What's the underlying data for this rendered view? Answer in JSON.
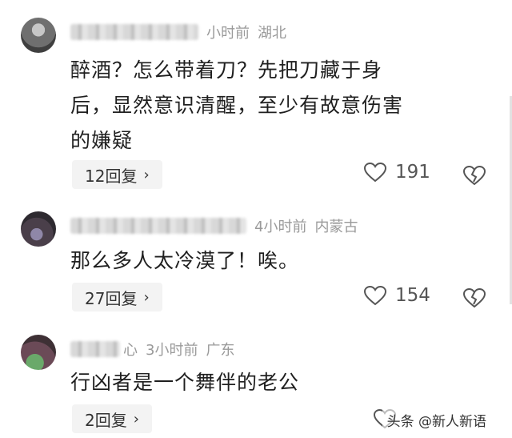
{
  "comments": [
    {
      "time": "小时前",
      "location": "湖北",
      "text_lines": [
        "醉酒？怎么带着刀？先把刀藏于身",
        "后，显然意识清醒，至少有故意伤害",
        "的嫌疑"
      ],
      "reply_label": "12回复",
      "likes": "191"
    },
    {
      "time": "4小时前",
      "location": "内蒙古",
      "text_lines": [
        "那么多人太冷漠了！唉。"
      ],
      "reply_label": "27回复",
      "likes": "154"
    },
    {
      "name_tail": "心",
      "time": "3小时前",
      "location": "广东",
      "text_lines": [
        "行凶者是一个舞伴的老公"
      ],
      "reply_label": "2回复"
    }
  ],
  "icons": {
    "chevron": "›",
    "like": "heart-outline-icon",
    "dislike": "broken-heart-icon"
  },
  "watermark": "头条 @新人新语",
  "colors": {
    "meta": "#9a9a9a",
    "text": "#1f1f1f",
    "reply_bg": "#f3f3f3",
    "icon": "#555555"
  }
}
